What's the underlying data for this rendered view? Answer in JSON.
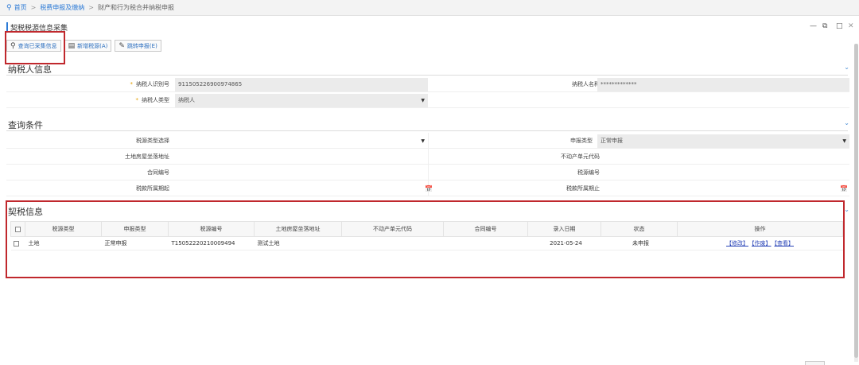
{
  "breadcrumb": {
    "home": "首页",
    "level2": "税费申报及缴纳",
    "current": "财产和行为税合并纳税申报"
  },
  "window": {
    "title": "契税税源信息采集"
  },
  "toolbar": {
    "query_label": "查询已采集信息",
    "add_label": "新增税源(A)",
    "jump_label": "跳转申报(E)"
  },
  "taxpayer": {
    "section_title": "纳税人信息",
    "id_label": "纳税人识别号",
    "id_value": "911505226900974865",
    "name_label": "纳税人名称",
    "name_value": "*************",
    "type_label": "纳税人类型",
    "type_value": "纳税人"
  },
  "query": {
    "section_title": "查询条件",
    "source_type_label": "税源类型选择",
    "source_type_value": "",
    "declare_type_label": "申报类型",
    "declare_type_value": "正常申报",
    "land_addr_label": "土地房屋坐落地址",
    "unit_code_label": "不动产单元代码",
    "contract_label": "合同编号",
    "source_no_label": "税源编号",
    "period_start_label": "税款所属期起",
    "period_end_label": "税款所属期止"
  },
  "grid": {
    "section_title": "契税信息",
    "columns": [
      "税源类型",
      "申报类型",
      "税源编号",
      "土地房屋坐落地址",
      "不动产单元代码",
      "合同编号",
      "录入日期",
      "状态",
      "操作"
    ],
    "rows": [
      {
        "source_type": "土地",
        "declare_type": "正常申报",
        "source_no": "T150522202100094​94",
        "address": "测试土地",
        "unit_code": "",
        "contract": "",
        "date": "2021-05-24",
        "status": "未申报",
        "ops": [
          "【修改】",
          "【作废】",
          "【查看】"
        ]
      }
    ]
  },
  "icons": {
    "location": "location-pin-icon",
    "search": "search-icon",
    "add": "add-doc-icon",
    "jump": "edit-icon",
    "calendar": "calendar-icon"
  },
  "colors": {
    "accent": "#2c7ad6",
    "highlight": "#c0282d",
    "required": "#e5a000",
    "link": "#2a45b8"
  }
}
